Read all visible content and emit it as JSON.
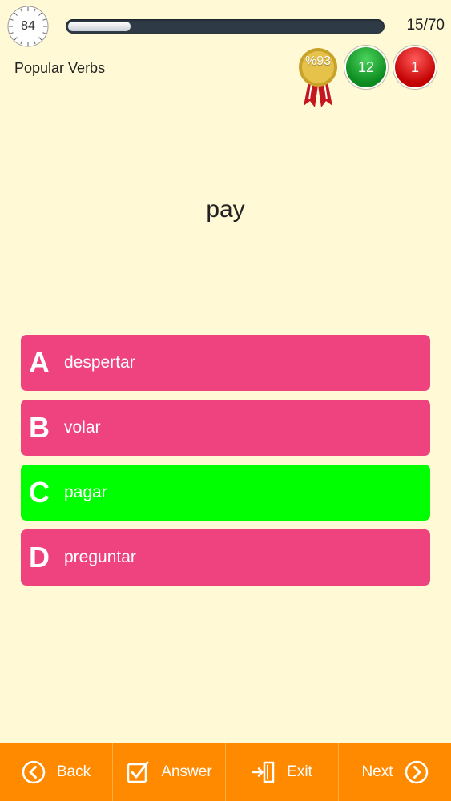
{
  "header": {
    "timer": "84",
    "progress_fraction": 0.2,
    "counter": "15/70",
    "category": "Popular Verbs",
    "score_percent": "%93",
    "correct_count": "12",
    "wrong_count": "1"
  },
  "question": "pay",
  "options": [
    {
      "letter": "A",
      "text": "despertar",
      "state": "normal"
    },
    {
      "letter": "B",
      "text": "volar",
      "state": "normal"
    },
    {
      "letter": "C",
      "text": "pagar",
      "state": "correct"
    },
    {
      "letter": "D",
      "text": "preguntar",
      "state": "normal"
    }
  ],
  "toolbar": {
    "back_label": "Back",
    "answer_label": "Answer",
    "exit_label": "Exit",
    "next_label": "Next"
  },
  "icons": {
    "timer": "stopwatch-icon",
    "medal": "medal-icon",
    "back": "chevron-left-circle-icon",
    "answer": "checkbox-icon",
    "exit": "exit-door-icon",
    "next": "chevron-right-circle-icon"
  },
  "colors": {
    "background": "#fff9d6",
    "option_default": "#ee437f",
    "option_correct": "#00ff00",
    "toolbar": "#ff8a00",
    "badge_correct": "#0c8a1f",
    "badge_wrong": "#c30000"
  }
}
